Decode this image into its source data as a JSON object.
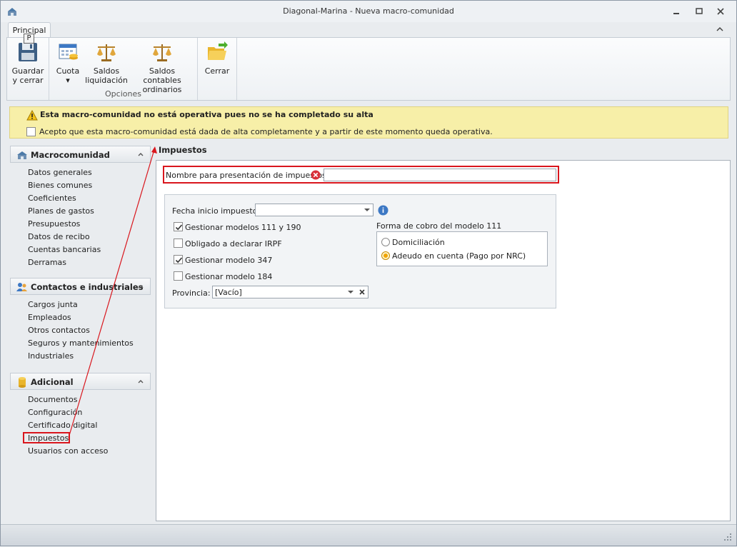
{
  "window": {
    "title": "Diagonal-Marina - Nueva macro-comunidad"
  },
  "ribbon": {
    "tab": "Principal",
    "keytip": "P",
    "buttons": {
      "save_line1": "Guardar",
      "save_line2": "y cerrar",
      "cuota": "Cuota",
      "cuota_dropdown": "▾",
      "saldos_liq_line1": "Saldos",
      "saldos_liq_line2": "liquidación",
      "saldos_cont_line1": "Saldos contables",
      "saldos_cont_line2": "ordinarios",
      "cerrar": "Cerrar"
    },
    "group_label": "Opciones"
  },
  "warning": {
    "title": "Esta macro-comunidad no está operativa pues no se ha completado su alta",
    "accept_label": "Acepto que esta macro-comunidad está dada de alta completamente y a partir de este momento queda operativa.",
    "accept_checked": false
  },
  "sidebar": {
    "groups": [
      {
        "title": "Macrocomunidad",
        "items": [
          "Datos generales",
          "Bienes comunes",
          "Coeficientes",
          "Planes de gastos",
          "Presupuestos",
          "Datos de recibo",
          "Cuentas bancarias",
          "Derramas"
        ]
      },
      {
        "title": "Contactos e industriales",
        "items": [
          "Cargos junta",
          "Empleados",
          "Otros contactos",
          "Seguros y mantenimientos",
          "Industriales"
        ]
      },
      {
        "title": "Adicional",
        "items": [
          "Documentos",
          "Configuración",
          "Certificado digital",
          "Impuestos",
          "Usuarios con acceso"
        ]
      }
    ],
    "selected": "Impuestos"
  },
  "content": {
    "title": "Impuestos",
    "name_label": "Nombre para presentación de impuestos:",
    "name_value": "",
    "fecha_label": "Fecha inicio impuestos:",
    "fecha_value": "",
    "check_111_190": {
      "label": "Gestionar modelos 111 y 190",
      "checked": true
    },
    "check_irpf": {
      "label": "Obligado a declarar IRPF",
      "checked": false
    },
    "check_347": {
      "label": "Gestionar modelo 347",
      "checked": true
    },
    "check_184": {
      "label": "Gestionar modelo 184",
      "checked": false
    },
    "provincia_label": "Provincia:",
    "provincia_value": "[Vacío]",
    "forma_cobro_title": "Forma de cobro del modelo 111",
    "radio_domiciliacion": {
      "label": "Domiciliación",
      "selected": false
    },
    "radio_adeudo": {
      "label": "Adeudo en cuenta (Pago por NRC)",
      "selected": true
    }
  },
  "colors": {
    "highlight_red": "#d9161d",
    "warning_bg": "#f7efa8",
    "radio_accent": "#f0a400"
  }
}
